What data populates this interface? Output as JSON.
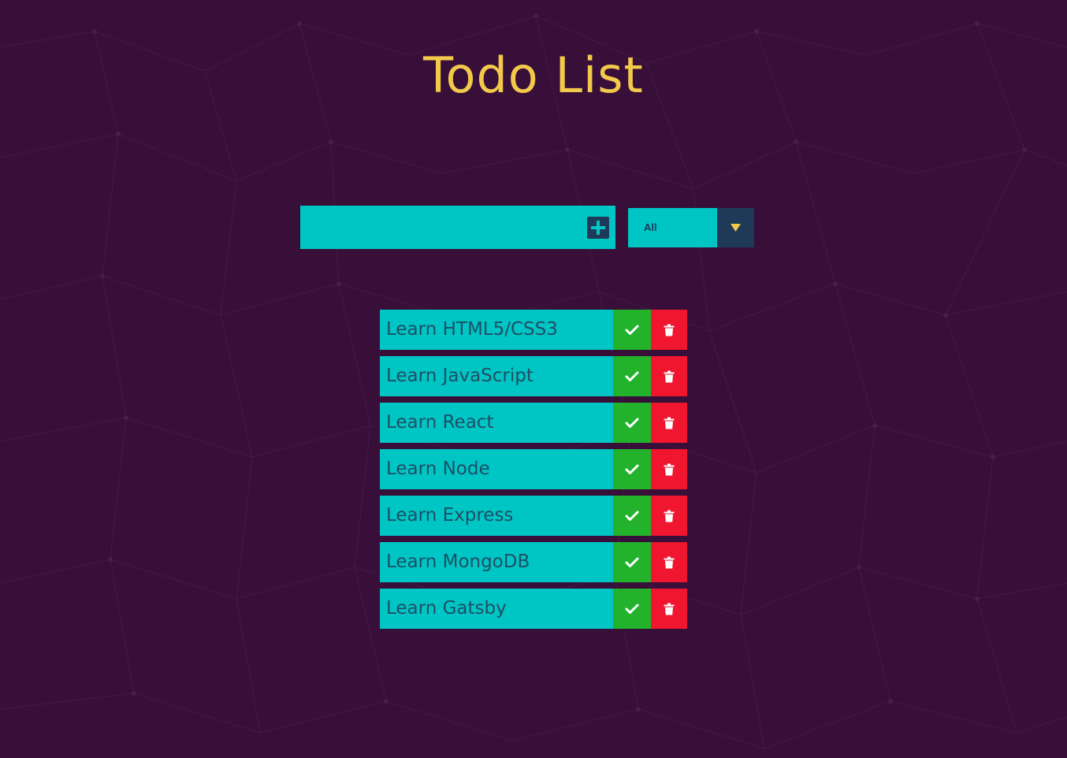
{
  "page": {
    "title": "Todo List",
    "background_color": "#370f38",
    "accent_color": "#f2c94a"
  },
  "form": {
    "input_value": "",
    "input_placeholder": "",
    "add_icon": "plus-square-icon",
    "filter": {
      "selected": "All",
      "arrow_icon": "caret-down-icon"
    }
  },
  "todos": [
    {
      "text": "Learn HTML5/CSS3"
    },
    {
      "text": "Learn JavaScript"
    },
    {
      "text": "Learn React"
    },
    {
      "text": "Learn Node"
    },
    {
      "text": "Learn Express"
    },
    {
      "text": "Learn MongoDB"
    },
    {
      "text": "Learn Gatsby"
    }
  ],
  "icons": {
    "complete": "check-icon",
    "delete": "trash-icon"
  },
  "colors": {
    "item_background": "#00c5c5",
    "complete_button": "#22b22c",
    "delete_button": "#f0162f",
    "dark_accent": "#1e3a58"
  }
}
